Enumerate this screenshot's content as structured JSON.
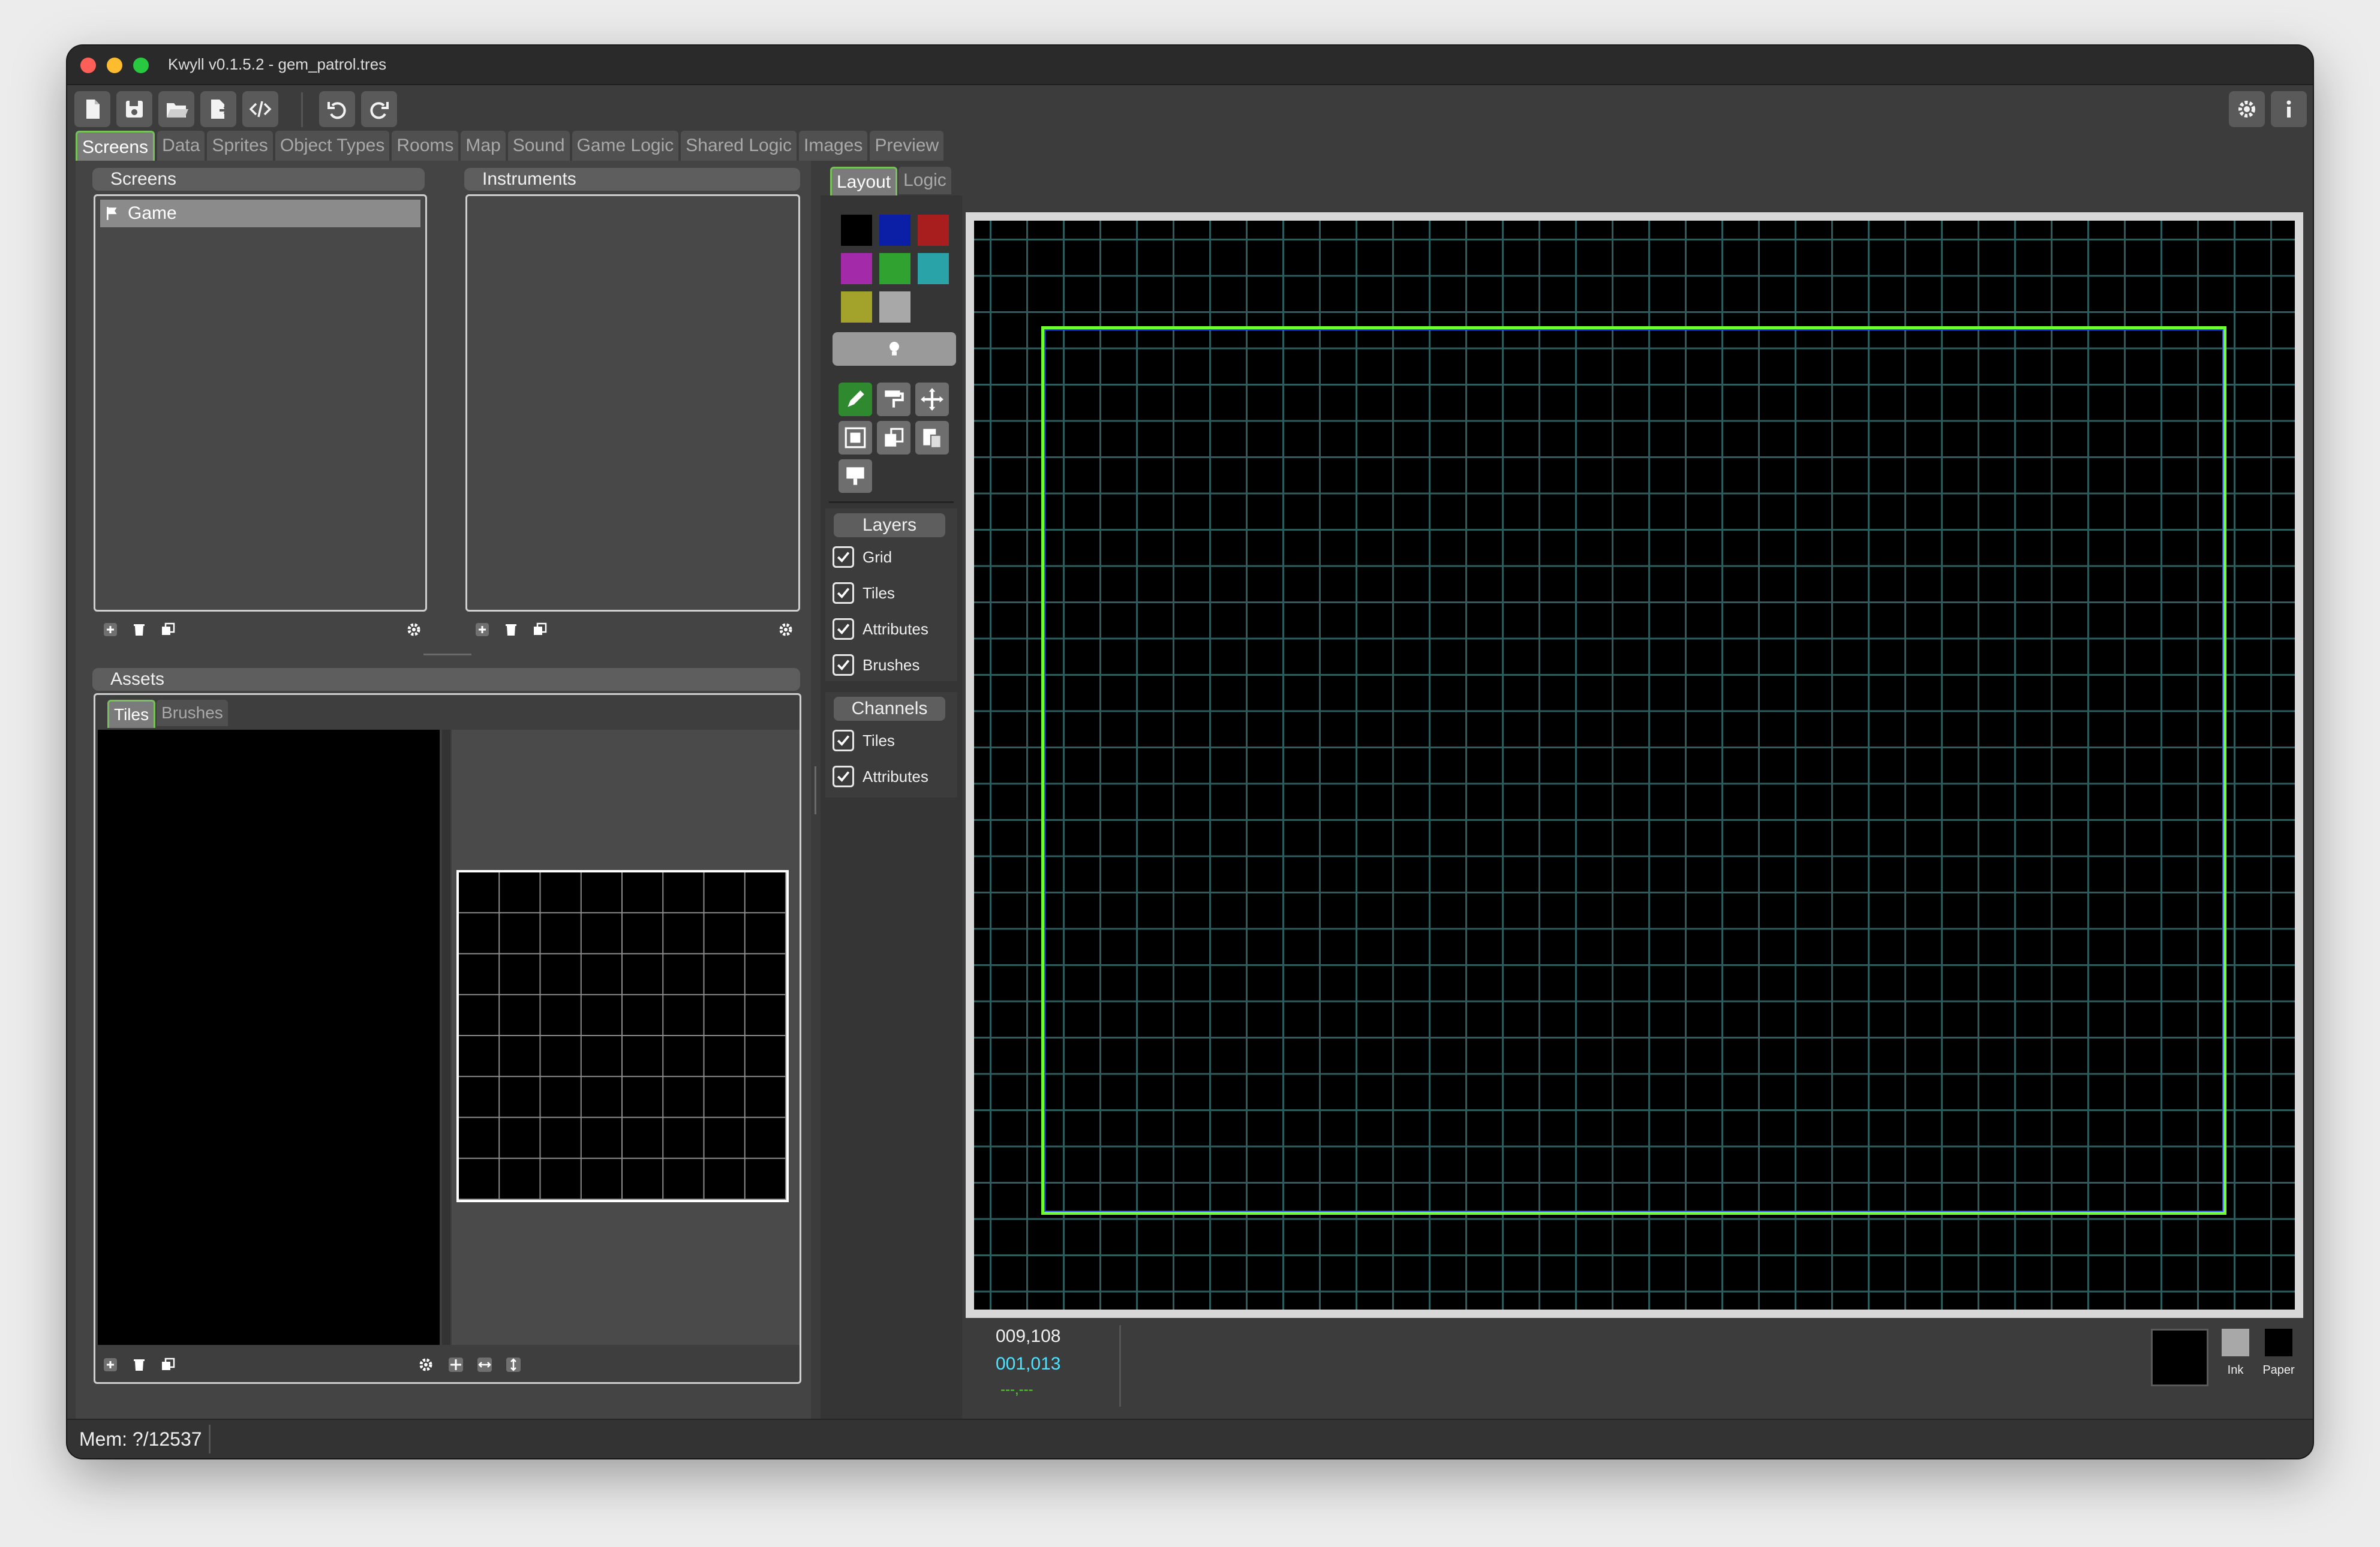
{
  "window": {
    "title": "Kwyll v0.1.5.2 - gem_patrol.tres"
  },
  "toolbar": {
    "buttons": [
      "new-file-icon",
      "save-icon",
      "open-folder-icon",
      "export-icon",
      "code-icon",
      "undo-icon",
      "redo-icon"
    ],
    "right_buttons": [
      "gear-icon",
      "info-icon"
    ]
  },
  "tabs": [
    "Screens",
    "Data",
    "Sprites",
    "Object Types",
    "Rooms",
    "Map",
    "Sound",
    "Game Logic",
    "Shared Logic",
    "Images",
    "Preview"
  ],
  "active_tab": "Screens",
  "screens_panel": {
    "header": "Screens",
    "items": [
      "Game"
    ]
  },
  "instruments_panel": {
    "header": "Instruments"
  },
  "assets_panel": {
    "header": "Assets",
    "tabs": [
      "Tiles",
      "Brushes"
    ],
    "active_tab": "Tiles"
  },
  "editor_tabs": {
    "layout": "Layout",
    "logic": "Logic",
    "active": "Layout"
  },
  "palette": [
    "#000000",
    "#0a1fa6",
    "#a81d1d",
    "#a32aa8",
    "#2fa22f",
    "#29a3a8",
    "#a3a32c",
    "#a8a8a8"
  ],
  "layers": {
    "header": "Layers",
    "items": [
      {
        "label": "Grid",
        "checked": true
      },
      {
        "label": "Tiles",
        "checked": true
      },
      {
        "label": "Attributes",
        "checked": true
      },
      {
        "label": "Brushes",
        "checked": true
      }
    ]
  },
  "channels": {
    "header": "Channels",
    "items": [
      {
        "label": "Tiles",
        "checked": true
      },
      {
        "label": "Attributes",
        "checked": true
      }
    ]
  },
  "coords": {
    "pixel": "009,108",
    "cell": "001,013",
    "extra": "---,---"
  },
  "ink_paper": {
    "ink_label": "Ink",
    "paper_label": "Paper"
  },
  "status": {
    "memory": "Mem: ?/12537"
  },
  "colors": {
    "accent_green": "#78c05a",
    "grid": "#2e5c5c",
    "selection": "#6fff2f"
  }
}
